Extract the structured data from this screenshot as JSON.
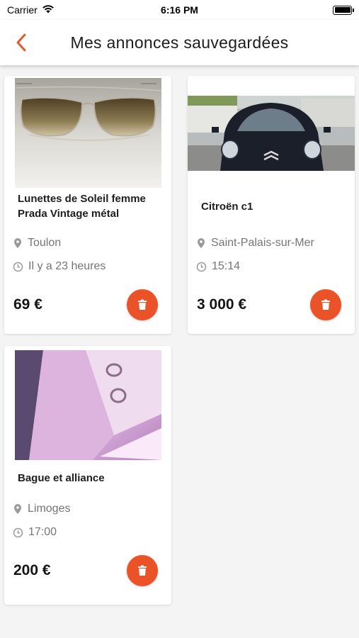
{
  "status_bar": {
    "carrier": "Carrier",
    "time": "6:16 PM"
  },
  "nav": {
    "title": "Mes annonces sauvegardées",
    "accent_color": "#ea5228"
  },
  "listings": [
    {
      "title": "Lunettes de Soleil femme Prada Vintage métal",
      "location": "Toulon",
      "time": "Il y a 23 heures",
      "price": "69 €",
      "image": "sunglasses-photo"
    },
    {
      "title": "Citroën c1",
      "location": "Saint-Palais-sur-Mer",
      "time": "15:14",
      "price": "3 000 €",
      "image": "car-photo"
    },
    {
      "title": "Bague et alliance",
      "location": "Limoges",
      "time": "17:00",
      "price": "200 €",
      "image": "rings-photo"
    }
  ]
}
